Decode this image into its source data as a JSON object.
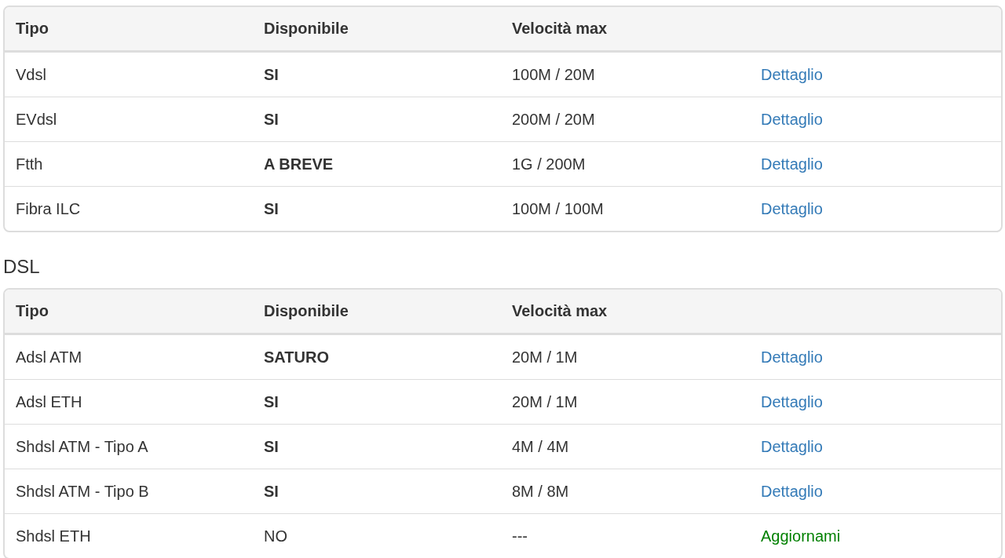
{
  "sections": [
    {
      "columns": [
        "Tipo",
        "Disponibile",
        "Velocità max"
      ],
      "rows": [
        {
          "tipo": "Vdsl",
          "disponibile": "SI",
          "bold": true,
          "velocita": "100M / 20M",
          "link": {
            "label": "Dettaglio",
            "kind": "detail"
          }
        },
        {
          "tipo": "EVdsl",
          "disponibile": "SI",
          "bold": true,
          "velocita": "200M / 20M",
          "link": {
            "label": "Dettaglio",
            "kind": "detail"
          }
        },
        {
          "tipo": "Ftth",
          "disponibile": "A BREVE",
          "bold": true,
          "velocita": "1G / 200M",
          "link": {
            "label": "Dettaglio",
            "kind": "detail"
          }
        },
        {
          "tipo": "Fibra ILC",
          "disponibile": "SI",
          "bold": true,
          "velocita": "100M / 100M",
          "link": {
            "label": "Dettaglio",
            "kind": "detail"
          }
        }
      ]
    },
    {
      "title": "DSL",
      "columns": [
        "Tipo",
        "Disponibile",
        "Velocità max"
      ],
      "rows": [
        {
          "tipo": "Adsl ATM",
          "disponibile": "SATURO",
          "bold": true,
          "velocita": "20M / 1M",
          "link": {
            "label": "Dettaglio",
            "kind": "detail"
          }
        },
        {
          "tipo": "Adsl ETH",
          "disponibile": "SI",
          "bold": true,
          "velocita": "20M / 1M",
          "link": {
            "label": "Dettaglio",
            "kind": "detail"
          }
        },
        {
          "tipo": "Shdsl ATM - Tipo A",
          "disponibile": "SI",
          "bold": true,
          "velocita": "4M / 4M",
          "link": {
            "label": "Dettaglio",
            "kind": "detail"
          }
        },
        {
          "tipo": "Shdsl ATM - Tipo B",
          "disponibile": "SI",
          "bold": true,
          "velocita": "8M / 8M",
          "link": {
            "label": "Dettaglio",
            "kind": "detail"
          }
        },
        {
          "tipo": "Shdsl ETH",
          "disponibile": "NO",
          "bold": false,
          "velocita": "---",
          "link": {
            "label": "Aggiornami",
            "kind": "update"
          }
        }
      ]
    }
  ]
}
